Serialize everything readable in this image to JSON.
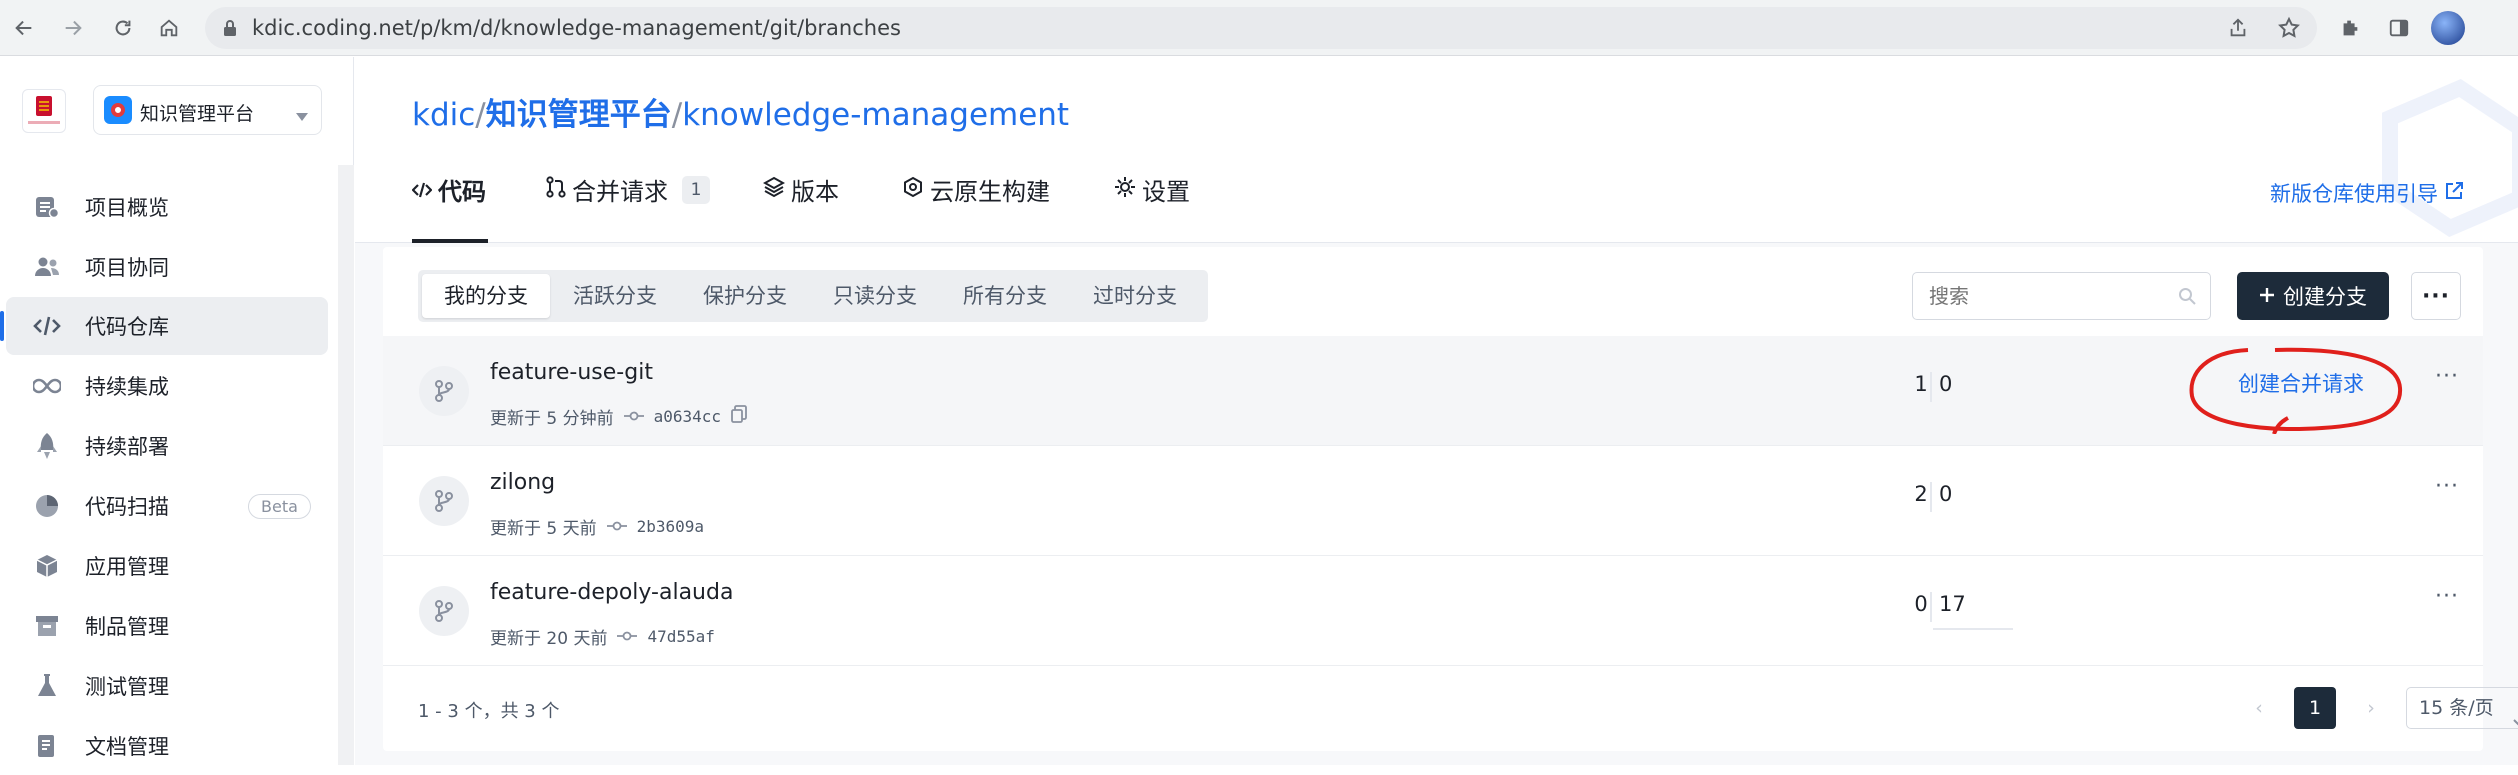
{
  "browser": {
    "url": "kdic.coding.net/p/km/d/knowledge-management/git/branches"
  },
  "sidebar": {
    "logo_caption": "KONGSBERG",
    "project_name": "知识管理平台",
    "items": [
      {
        "label": "项目概览",
        "icon": "overview-icon"
      },
      {
        "label": "项目协同",
        "icon": "team-icon"
      },
      {
        "label": "代码仓库",
        "icon": "code-icon",
        "active": true
      },
      {
        "label": "持续集成",
        "icon": "infinity-icon"
      },
      {
        "label": "持续部署",
        "icon": "rocket-icon"
      },
      {
        "label": "代码扫描",
        "icon": "pie-icon",
        "badge": "Beta"
      },
      {
        "label": "应用管理",
        "icon": "cube-icon"
      },
      {
        "label": "制品管理",
        "icon": "archive-icon"
      },
      {
        "label": "测试管理",
        "icon": "flask-icon"
      },
      {
        "label": "文档管理",
        "icon": "doc-icon"
      }
    ]
  },
  "header": {
    "crumb_org": "kdic",
    "crumb_sep": "/",
    "crumb_project": "知识管理平台",
    "crumb_repo": "knowledge-management",
    "tabs": [
      {
        "label": "代码",
        "icon": "code-icon"
      },
      {
        "label": "合并请求",
        "icon": "merge-icon",
        "badge": "1"
      },
      {
        "label": "版本",
        "icon": "layers-icon"
      },
      {
        "label": "云原生构建",
        "icon": "cloud-build-icon"
      },
      {
        "label": "设置",
        "icon": "gear-icon"
      }
    ],
    "guide_link": "新版仓库使用引导"
  },
  "filters": {
    "tabs": [
      "我的分支",
      "活跃分支",
      "保护分支",
      "只读分支",
      "所有分支",
      "过时分支"
    ],
    "active": "我的分支",
    "search_placeholder": "搜索",
    "create_label": "创建分支",
    "more_label": "···"
  },
  "branches": [
    {
      "name": "feature-use-git",
      "updated": "更新于 5 分钟前",
      "commit": "a0634cc",
      "ahead": "1",
      "behind": "0",
      "action": "创建合并请求"
    },
    {
      "name": "zilong",
      "updated": "更新于 5 天前",
      "commit": "2b3609a",
      "ahead": "2",
      "behind": "0"
    },
    {
      "name": "feature-depoly-alauda",
      "updated": "更新于 20 天前",
      "commit": "47d55af",
      "ahead": "0",
      "behind": "17"
    }
  ],
  "footer": {
    "range_text": "1 - 3 个，共 3 个",
    "current_page": "1",
    "page_size": "15 条/页"
  },
  "colors": {
    "accent": "#1f6ee8",
    "dark": "#1d2b3a",
    "annotation": "#e0201c"
  }
}
